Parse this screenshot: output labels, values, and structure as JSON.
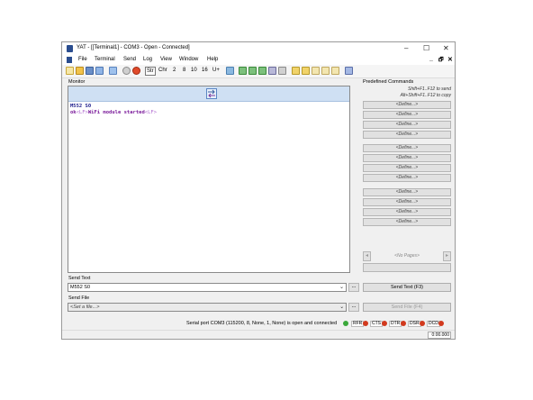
{
  "window": {
    "title": "YAT - [[Terminal1] - COM3 - Open - Connected]",
    "controls": [
      "–",
      "☐",
      "✕"
    ]
  },
  "menu": {
    "items": [
      "File",
      "Terminal",
      "Send",
      "Log",
      "View",
      "Window",
      "Help"
    ],
    "mdi_controls": [
      "_",
      "🗗",
      "✕"
    ]
  },
  "toolbar": {
    "str": "Str",
    "chr": "Chr",
    "radix": [
      "2",
      "8",
      "10",
      "16",
      "U+"
    ]
  },
  "monitor": {
    "label": "Monitor",
    "lines": [
      {
        "text": "M552 S0"
      },
      {
        "pre": "ok",
        "ctl1": "<LF>",
        "mid": "WiFi module started",
        "ctl2": "<LF>"
      }
    ]
  },
  "predefined": {
    "label": "Predefined Commands",
    "hint1": "Shift+F1..F12 to send",
    "hint2": "Alt+Shift+F1..F12 to copy",
    "define_label": "<Define...>",
    "pages": "<No Pages>"
  },
  "send_text": {
    "label": "Send Text",
    "value": "M552 S0",
    "browse": "...",
    "button": "Send Text (F3)"
  },
  "send_file": {
    "label": "Send File",
    "value": "<Set a file...>",
    "browse": "...",
    "button": "Send File (F4)"
  },
  "status": {
    "text": "Serial port COM3 (115200, 8, None, 1, None) is open and connected",
    "signals": [
      {
        "name": "RFR",
        "color": "#d23a1e"
      },
      {
        "name": "CTS",
        "color": "#d23a1e"
      },
      {
        "name": "DTR",
        "color": "#d23a1e"
      },
      {
        "name": "DSR",
        "color": "#d23a1e"
      },
      {
        "name": "DCD",
        "color": "#d23a1e"
      }
    ],
    "connected_color": "#3aa83a",
    "time": "0:00.000"
  }
}
